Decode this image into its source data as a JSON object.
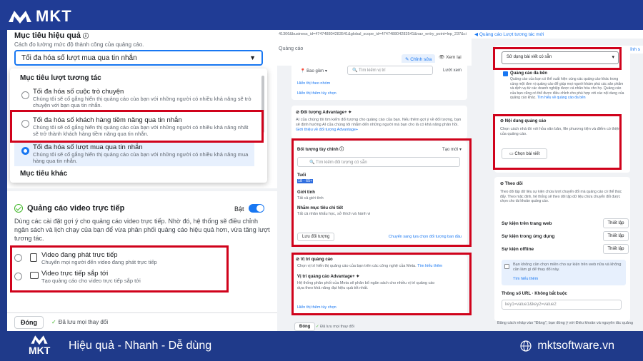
{
  "brand": {
    "name": "MKT",
    "slogan": "Hiệu quả - Nhanh - Dễ dùng",
    "site": "mktsoftware.vn"
  },
  "p1": {
    "goal_title": "Mục tiêu hiệu quả",
    "goal_sub": "Cách đo lường mức độ thành công của quảng cáo.",
    "goal_selected": "Tối đa hóa số lượt mua qua tin nhắn",
    "group1": "Mục tiêu lượt tương tác",
    "options": [
      {
        "title": "Tối đa hóa số cuộc trò chuyện",
        "desc": "Chúng tôi sẽ cố gắng hiển thị quảng cáo của bạn với những người có nhiều khả năng sẽ trò chuyện với bạn qua tin nhắn."
      },
      {
        "title": "Tối đa hóa số khách hàng tiềm năng qua tin nhắn",
        "desc": "Chúng tôi sẽ cố gắng hiển thị quảng cáo của bạn với những người có nhiều khả năng nhất sẽ trở thành khách hàng tiềm năng qua tin nhắn."
      },
      {
        "title": "Tối đa hóa số lượt mua qua tin nhắn",
        "desc": "Chúng tôi sẽ cố gắng hiển thị quảng cáo của bạn với những người có nhiều khả năng mua hàng qua tin nhắn."
      }
    ],
    "group2": "Mục tiêu khác",
    "video_title": "Quảng cáo video trực tiếp",
    "toggle_label": "Bật",
    "video_desc": "Dùng các cài đặt gợi ý cho quảng cáo video trực tiếp. Nhờ đó, hệ thống sẽ điều chỉnh ngân sách và lịch chạy của bạn để vừa phân phối quảng cáo hiệu quả hơn, vừa tăng lượt tương tác.",
    "video_opts": [
      {
        "title": "Video đang phát trực tiếp",
        "desc": "Chuyển mọi người đến video đang phát trực tiếp"
      },
      {
        "title": "Video trực tiếp sắp tới",
        "desc": "Tạo quảng cáo cho video trực tiếp sắp tới"
      }
    ],
    "close_btn": "Đóng",
    "saved": "Đã lưu mọi thay đổi"
  },
  "p2": {
    "url": "41306&business_id=474748804283541&global_scope_id=474748804283541&nav_entry_point=lep_237&ci",
    "header_label": "Quảng cáo",
    "edit": "Chỉnh sửa",
    "view": "Xem lại",
    "include": "Bao gồm",
    "search_place": "Tìm kiếm vị trí",
    "browse": "Lướt xem",
    "tiny1": "Hiển thị theo nhóm",
    "more1": "Hiển thị thêm tùy chọn",
    "adv_title": "Đối tượng Advantage+",
    "adv_desc": "AI của chúng tôi tìm kiếm đối tượng cho quảng cáo của bạn. Nếu thêm gợi ý về đối tượng, bạn sẽ định hướng AI của chúng tôi nhắm đến những người mà bạn cho là có khả năng phản hồi.",
    "adv_link": "Giới thiệu về đối tượng Advantage+",
    "custom_title": "Đối tượng tùy chỉnh",
    "create_new": "Tạo mới",
    "search_aud": "Tìm kiếm đối tượng có sẵn",
    "age": "Tuổi",
    "age_val": "18 - 65+",
    "gender": "Giới tính",
    "gender_val": "Tất cả giới tính",
    "detail": "Nhắm mục tiêu chi tiết",
    "detail_val": "Tất cả nhân khẩu học, sở thích và hành vi",
    "save_aud": "Lưu đối tượng",
    "switch": "Chuyển sang lựa chọn đối tượng ban đầu",
    "place_title": "Vị trí quảng cáo",
    "place_desc": "Chọn vị trí hiển thị quảng cáo của bạn trên các công nghệ của Meta.",
    "place_more": "Tìm hiểu thêm",
    "place_adv": "Vị trí quảng cáo Advantage+",
    "place_adv_desc": "Hệ thống phân phối của Meta sẽ phân bổ ngân sách cho nhiều vị trí quảng cáo dựa theo khả năng đạt hiệu quả tốt nhất.",
    "more2": "Hiển thị thêm tùy chọn",
    "close_btn": "Đóng",
    "saved": "Đã lưu mọi thay đổi"
  },
  "p3": {
    "top": "Quảng cáo Lượt tương tác mới",
    "right_top": "Chỉnh s",
    "select": "Sử dụng bài viết có sẵn",
    "partner_title": "Quảng cáo đa bên",
    "partner_desc": "Quảng cáo của bạn có thể xuất hiện cùng các quảng cáo khác trong cùng một đơn vị quảng cáo để giúp mọi người khám phá các sản phẩm và dịch vụ từ các doanh nghiệp được cá nhân hóa cho họ. Quảng cáo của bạn cũng có thể được điều chỉnh cho phù hợp với các nội dung của quảng cáo khác.",
    "partner_link": "Tìm hiểu về quảng cáo đa bên",
    "content_title": "Nội dung quảng cáo",
    "content_desc": "Chọn cách nhà tôi với hỏa văn bản, file phương tiện và điểm có thiện của quảng cáo.",
    "choose_post": "Chọn bài viết",
    "track_title": "Theo dõi",
    "track_desc": "Theo dõi tập dữ liệu sự kiện chứa lượt chuyển đổi mà quảng cáo có thể thúc đẩy. Theo mặc định, hệ thống sẽ theo dõi tập dữ liệu chứa chuyển đổi được chọn cho tài khoản quảng cáo.",
    "events": [
      {
        "label": "Sự kiện trên trang web",
        "btn": "Thiết lập"
      },
      {
        "label": "Sự kiện trong ứng dụng",
        "btn": "Thiết lập"
      },
      {
        "label": "Sự kiện offline",
        "btn": "Thiết lập"
      }
    ],
    "notice": "Bạn không cần chọn miền cho sự kiện trên web nữa và không cần làm gì để thay đổi này.",
    "notice_link": "Tìm hiểu thêm",
    "url_label": "Thông số URL · Không bắt buộc",
    "url_place": "key1=value1&key2=value2",
    "legal": "Bằng cách nhấp vào \"Đăng\", bạn đồng ý với Điều khoản và nguyên tắc quảng"
  }
}
